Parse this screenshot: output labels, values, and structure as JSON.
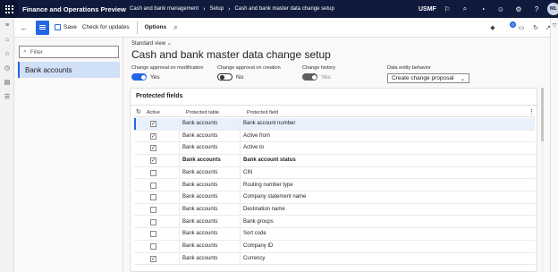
{
  "topbar": {
    "app_name": "Finance and Operations Preview",
    "breadcrumbs": [
      "Cash and bank management",
      "Setup",
      "Cash and bank master data change setup"
    ],
    "company": "USMF",
    "avatar_initials": "ML"
  },
  "cmdbar": {
    "save_label": "Save",
    "check_updates_label": "Check for updates",
    "options_label": "Options",
    "notification_count": "0"
  },
  "leftpane": {
    "filter_placeholder": "Filter",
    "items": [
      {
        "label": "Bank accounts"
      }
    ]
  },
  "main": {
    "view_label": "Standard view",
    "title": "Cash and bank master data change setup",
    "fields": {
      "approval_modification": {
        "label": "Change approval on modification",
        "value": "Yes"
      },
      "approval_creation": {
        "label": "Change approval on creation",
        "value": "No"
      },
      "change_history": {
        "label": "Change history",
        "value": "Yes"
      },
      "entity_behavior": {
        "label": "Data entity behavior",
        "value": "Create change proposal"
      }
    },
    "protected_fields": {
      "header": "Protected fields",
      "columns": {
        "active": "Active",
        "table": "Protected table",
        "field": "Protected field"
      },
      "rows": [
        {
          "active": true,
          "table": "Bank accounts",
          "field": "Bank account number",
          "bold": false,
          "selected": true
        },
        {
          "active": true,
          "table": "Bank accounts",
          "field": "Active from",
          "bold": false,
          "selected": false
        },
        {
          "active": true,
          "table": "Bank accounts",
          "field": "Active to",
          "bold": false,
          "selected": false
        },
        {
          "active": true,
          "table": "Bank accounts",
          "field": "Bank account status",
          "bold": true,
          "selected": false
        },
        {
          "active": false,
          "table": "Bank accounts",
          "field": "CIN",
          "bold": false,
          "selected": false
        },
        {
          "active": false,
          "table": "Bank accounts",
          "field": "Routing number type",
          "bold": false,
          "selected": false
        },
        {
          "active": false,
          "table": "Bank accounts",
          "field": "Company statement name",
          "bold": false,
          "selected": false
        },
        {
          "active": false,
          "table": "Bank accounts",
          "field": "Destination name",
          "bold": false,
          "selected": false
        },
        {
          "active": false,
          "table": "Bank accounts",
          "field": "Bank groups",
          "bold": false,
          "selected": false
        },
        {
          "active": false,
          "table": "Bank accounts",
          "field": "Sort code",
          "bold": false,
          "selected": false
        },
        {
          "active": false,
          "table": "Bank accounts",
          "field": "Company ID",
          "bold": false,
          "selected": false
        },
        {
          "active": true,
          "table": "Bank accounts",
          "field": "Currency",
          "bold": false,
          "selected": false
        }
      ]
    }
  },
  "colors": {
    "topbar": "#0f1a3d",
    "accent": "#2266e3"
  }
}
